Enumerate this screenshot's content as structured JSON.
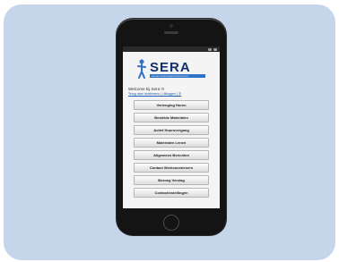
{
  "app": {
    "logo_text": "SERA",
    "logo_sub": "seracontainmentsolutions",
    "welcome": "Welcome bij Sera !!!",
    "subline": "Terug naar hoofdmenu | Uitloggen | Ⓡ"
  },
  "menu": [
    {
      "label": "Verlenging Huren"
    },
    {
      "label": "Bestelde Materialen"
    },
    {
      "label": "Actief Huurovergang"
    },
    {
      "label": "Materialen Lenen"
    },
    {
      "label": "Allgemeen Berichten"
    },
    {
      "label": "Contact Werkvoorzieners"
    },
    {
      "label": "Bezoeg Verslag"
    },
    {
      "label": "Contactinstellingen"
    }
  ],
  "colors": {
    "card_bg": "#c6d6ea",
    "logo_dark": "#12306b",
    "logo_blue": "#2e73c4"
  }
}
